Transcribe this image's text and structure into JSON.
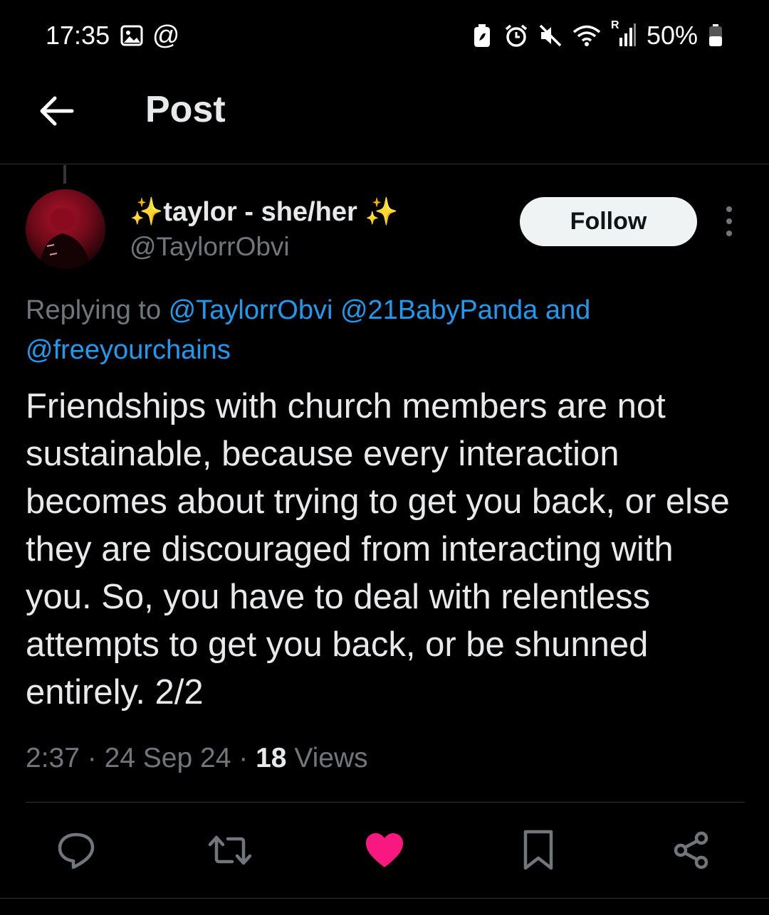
{
  "status_bar": {
    "time": "17:35",
    "battery": "50%",
    "icons": [
      "image-icon",
      "at-icon",
      "battery-saver-icon",
      "alarm-icon",
      "mute-icon",
      "wifi-icon",
      "signal-icon",
      "battery-icon"
    ],
    "at_symbol": "@",
    "roaming": "R"
  },
  "header": {
    "title": "Post",
    "back_icon": "back-arrow-icon"
  },
  "tweet": {
    "display_name": "✨taylor - she/her ✨",
    "handle": "@TaylorrObvi",
    "follow_label": "Follow",
    "replying_prefix": "Replying to ",
    "replying_links": [
      "@TaylorrObvi",
      "@21BabyPanda",
      "and",
      "@freeyourchains"
    ],
    "text": "Friendships with church members are not sustainable, because every interaction becomes about trying to get you back, or else they are discouraged from interacting with you. So, you have to deal with relentless attempts to get you back, or be shunned entirely. 2/2",
    "time": "2:37",
    "date": "24 Sep 24",
    "views_count": "18",
    "views_label": "Views",
    "separator": " · ",
    "liked": true
  },
  "actions": [
    "reply-icon",
    "retweet-icon",
    "like-icon",
    "bookmark-icon",
    "share-icon"
  ],
  "colors": {
    "background": "#000000",
    "text": "#e7e9ea",
    "muted": "#71767b",
    "link": "#1d9bf0",
    "like": "#f91880",
    "follow_bg": "#eff3f4"
  }
}
